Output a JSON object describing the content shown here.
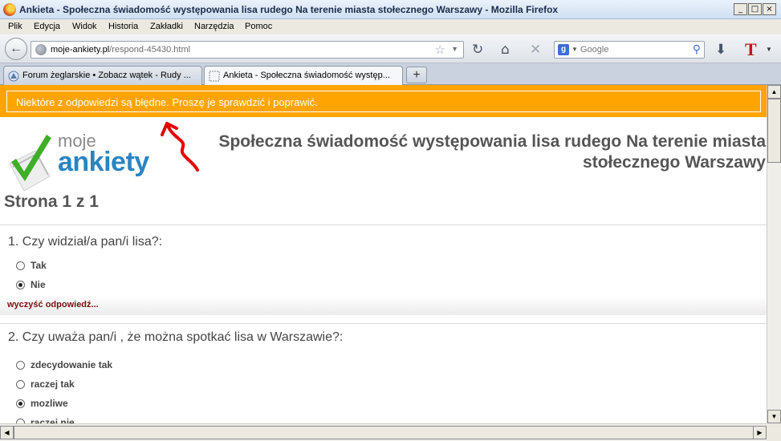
{
  "window": {
    "title": "Ankieta - Społeczna świadomość występowania lisa rudego Na terenie miasta stołecznego Warszawy - Mozilla Firefox",
    "minimize": "_",
    "maximize": "□",
    "close": "×"
  },
  "menu": [
    "Plik",
    "Edycja",
    "Widok",
    "Historia",
    "Zakładki",
    "Narzędzia",
    "Pomoc"
  ],
  "navigation": {
    "url_domain": "moje-ankiety.pl",
    "url_path": "/respond-45430.html",
    "search_placeholder": "Google",
    "search_engine_icon": "google-icon"
  },
  "tabs": [
    {
      "label": "Forum żeglarskie • Zobacz wątek - Rudy ...",
      "active": false,
      "icon": "forum-icon"
    },
    {
      "label": "Ankieta - Społeczna świadomość występ...",
      "active": true,
      "icon": "page-icon"
    }
  ],
  "page": {
    "error_message": "Niektóre z odpowiedzi są błędne. Proszę je sprawdzić i poprawić.",
    "logo": {
      "word1": "moje",
      "word2": "ankiety"
    },
    "survey_title": "Społeczna świadomość występowania lisa rudego Na terenie miasta\nstołecznego Warszawy",
    "page_indicator": "Strona 1 z 1",
    "questions": [
      {
        "title": "1. Czy widział/a pan/i lisa?:",
        "options": [
          {
            "label": "Tak",
            "selected": false
          },
          {
            "label": "Nie",
            "selected": true
          }
        ],
        "clear_label": "wyczyść odpowiedź..."
      },
      {
        "title": "2. Czy uważa pan/i , że można spotkać lisa w Warszawie?:",
        "options": [
          {
            "label": "zdecydowanie tak",
            "selected": false
          },
          {
            "label": "raczej tak",
            "selected": false
          },
          {
            "label": "mozliwe",
            "selected": true
          },
          {
            "label": "raczej nie",
            "selected": false
          }
        ]
      }
    ]
  },
  "colors": {
    "error_band": "#ffa400",
    "logo_blue": "#2b84c2",
    "logo_check": "#3fae2a",
    "link": "#7a0f0f",
    "annotation_arrow": "#e60000"
  }
}
